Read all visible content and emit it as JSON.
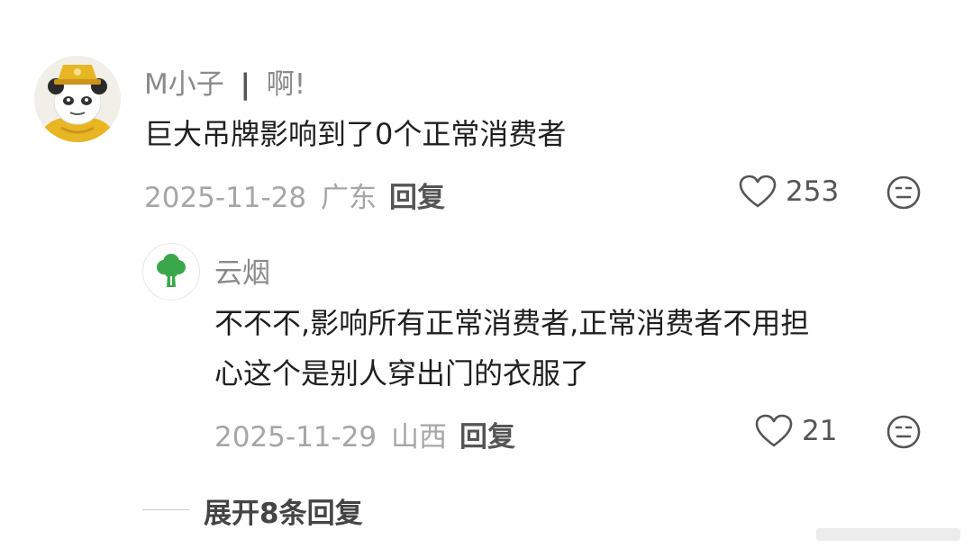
{
  "comment": {
    "username": "M小子",
    "separator": "|",
    "user_tag": "啊!",
    "text": "巨大吊牌影响到了0个正常消费者",
    "date": "2025-11-28",
    "location": "广东",
    "reply_label": "回复",
    "likes": "253",
    "avatar_icon": "panda-meme-avatar",
    "like_icon": "heart-outline-icon",
    "more_icon": "neutral-face-icon"
  },
  "reply": {
    "username": "云烟",
    "text_line1": "不不不,影响所有正常消费者,正常消费者不用担",
    "text_line2": "心这个是别人穿出门的衣服了",
    "date": "2025-11-29",
    "location": "山西",
    "reply_label": "回复",
    "likes": "21",
    "avatar_icon": "broccoli-avatar",
    "like_icon": "heart-outline-icon",
    "more_icon": "neutral-face-icon"
  },
  "expand": {
    "label": "展开8条回复"
  },
  "colors": {
    "meta_gray": "#a6a6a6",
    "username_gray": "#8a8a8a",
    "text_dark": "#1f1f1f",
    "broccoli_green": "#3aa84a"
  }
}
